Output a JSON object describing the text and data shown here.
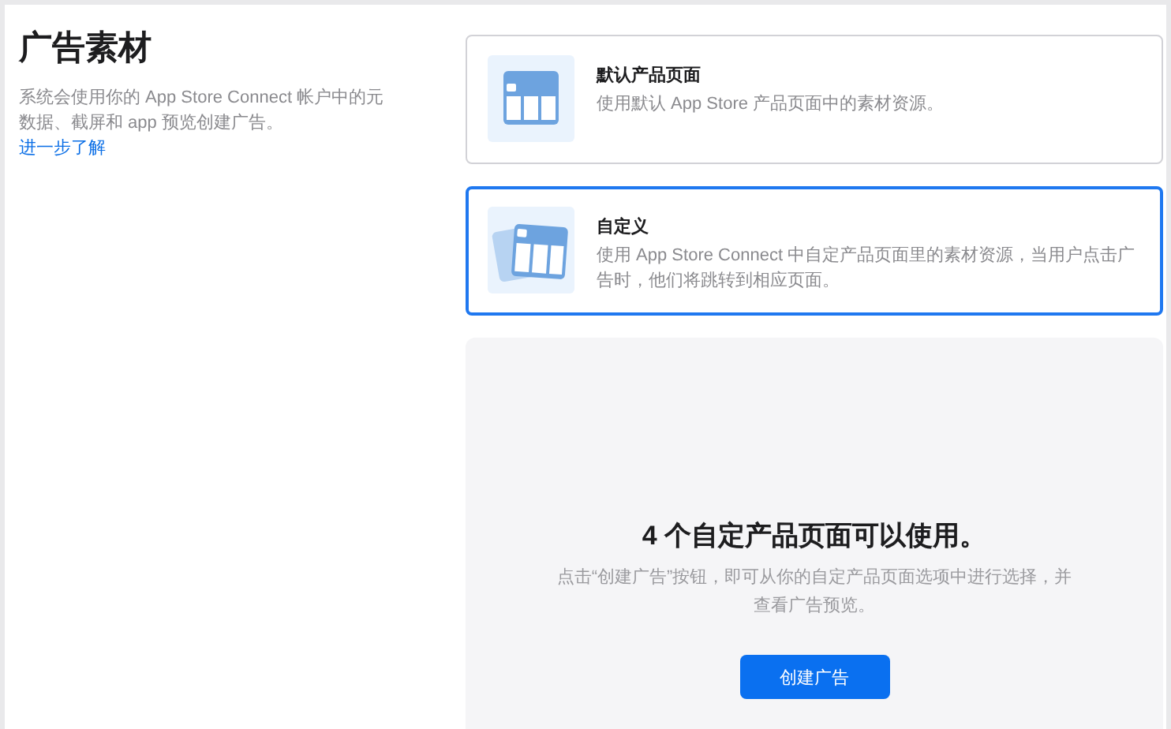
{
  "intro": {
    "title": "广告素材",
    "description": "系统会使用你的 App Store Connect 帐户中的元数据、截屏和 app 预览创建广告。",
    "link": "进一步了解"
  },
  "options": [
    {
      "kind": "single",
      "title": "默认产品页面",
      "description": "使用默认 App Store 产品页面中的素材资源。",
      "selected": false
    },
    {
      "kind": "stack",
      "title": "自定义",
      "description": "使用 App Store Connect 中自定产品页面里的素材资源，当用户点击广告时，他们将跳转到相应页面。",
      "selected": true
    }
  ],
  "panel": {
    "heading": "4 个自定产品页面可以使用。",
    "description": "点击“创建广告”按钮，即可从你的自定产品页面选项中进行选择，并查看广告预览。",
    "button": "创建广告"
  }
}
